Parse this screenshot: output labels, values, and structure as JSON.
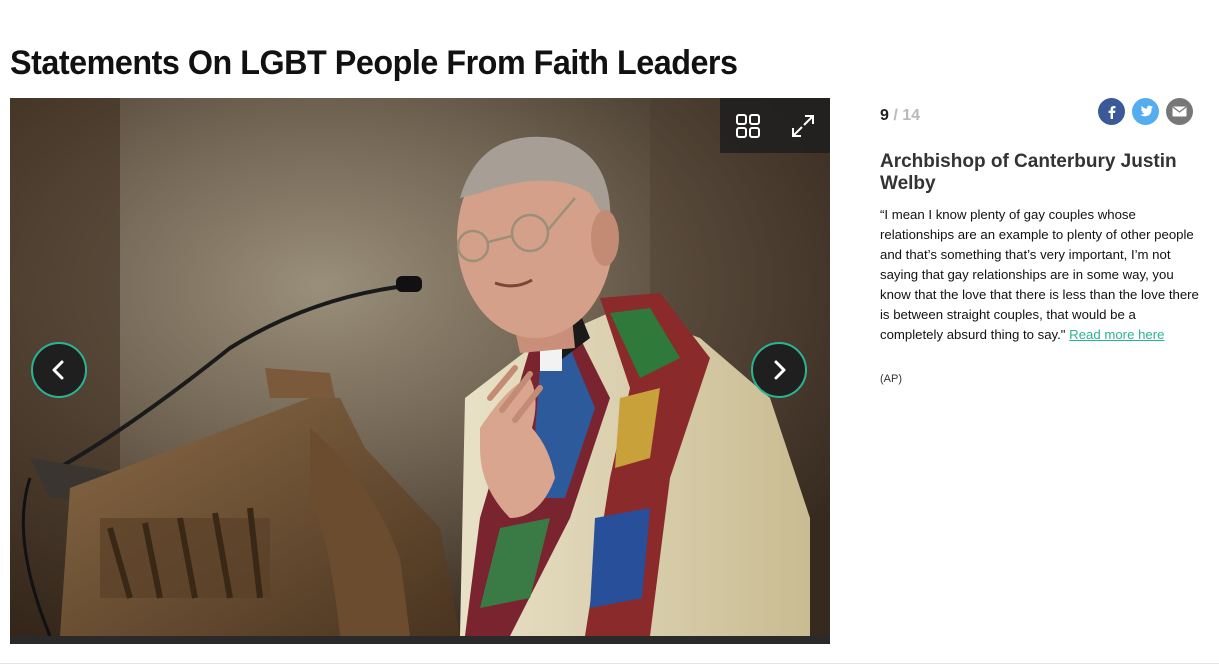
{
  "page": {
    "title": "Statements On LGBT People From Faith Leaders"
  },
  "slideshow": {
    "current": "9",
    "separator": "/",
    "total": "14",
    "prev_icon": "chevron-left-icon",
    "next_icon": "chevron-right-icon",
    "toolbar": {
      "grid_icon": "grid-view-icon",
      "fullscreen_icon": "fullscreen-icon"
    },
    "accent_color": "#2bb493"
  },
  "share": [
    {
      "network": "facebook",
      "icon": "facebook-icon",
      "color": "#3b5998"
    },
    {
      "network": "twitter",
      "icon": "twitter-icon",
      "color": "#55acee"
    },
    {
      "network": "email",
      "icon": "email-icon",
      "color": "#777777"
    }
  ],
  "slide": {
    "title": "Archbishop of Canterbury Justin Welby",
    "caption": "“I mean I know plenty of gay couples whose relationships are an example to plenty of other people and that’s something that’s very important, I’m not saying that gay relationships are in some way, you know that the love that there is less than the love there is between straight couples, that would be a completely absurd thing to say.\"",
    "link_text": "Read more here",
    "credit": "(AP)"
  }
}
